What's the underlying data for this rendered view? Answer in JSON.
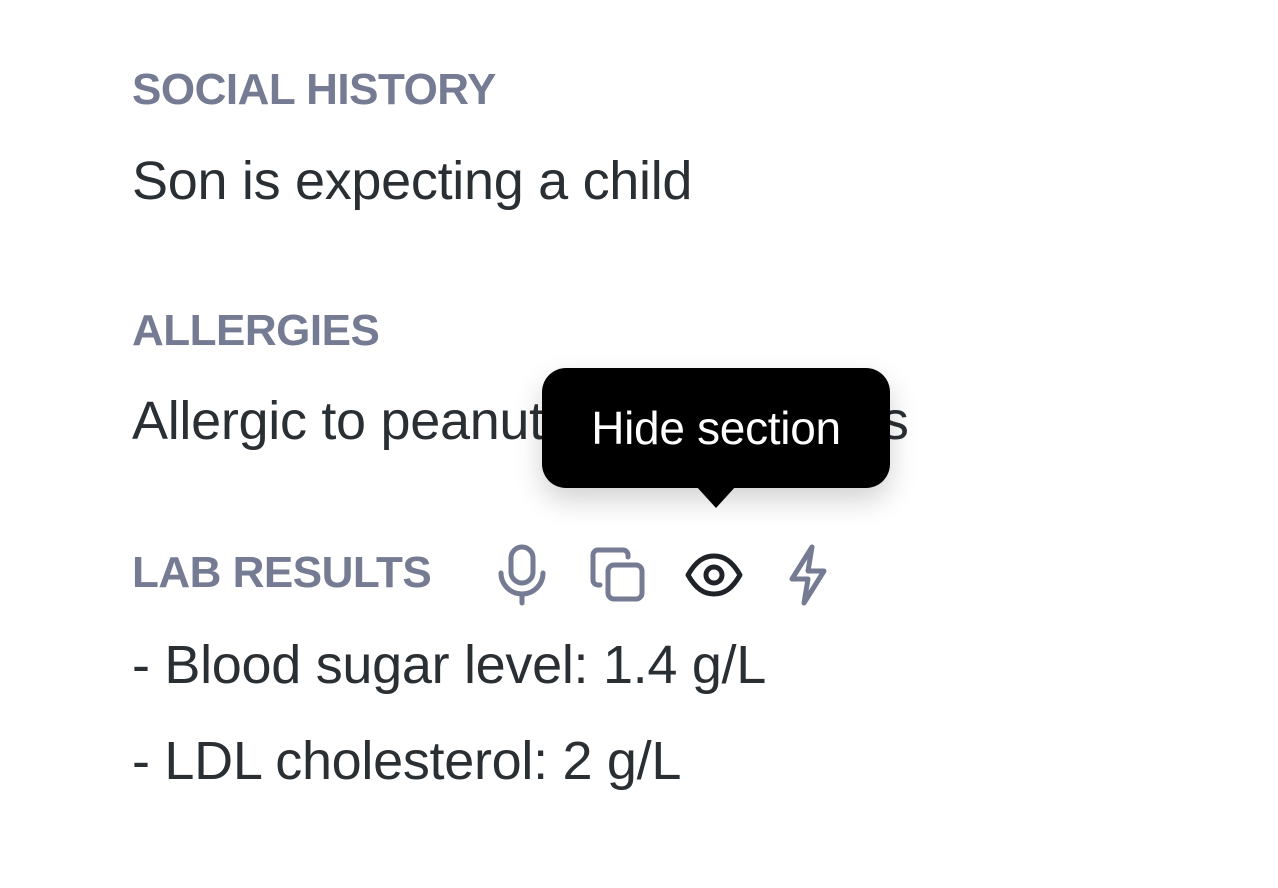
{
  "sections": {
    "social_history": {
      "heading": "SOCIAL HISTORY",
      "text": "Son is expecting a child"
    },
    "allergies": {
      "heading": "ALLERGIES",
      "text": "Allergic to peanuts, causes hives"
    },
    "lab_results": {
      "heading": "LAB RESULTS",
      "lines": [
        "- Blood sugar level: 1.4 g/L",
        "- LDL cholesterol: 2 g/L"
      ],
      "toolbar": [
        {
          "icon": "microphone-icon",
          "color": "#747b92"
        },
        {
          "icon": "copy-icon",
          "color": "#747b92"
        },
        {
          "icon": "eye-icon",
          "color": "#1f2328"
        },
        {
          "icon": "lightning-icon",
          "color": "#747b92"
        }
      ]
    }
  },
  "tooltip": {
    "label": "Hide section"
  },
  "colors": {
    "heading": "#747b92",
    "body_text": "#2a2f34",
    "tooltip_bg": "#000000",
    "tooltip_text": "#ffffff"
  }
}
